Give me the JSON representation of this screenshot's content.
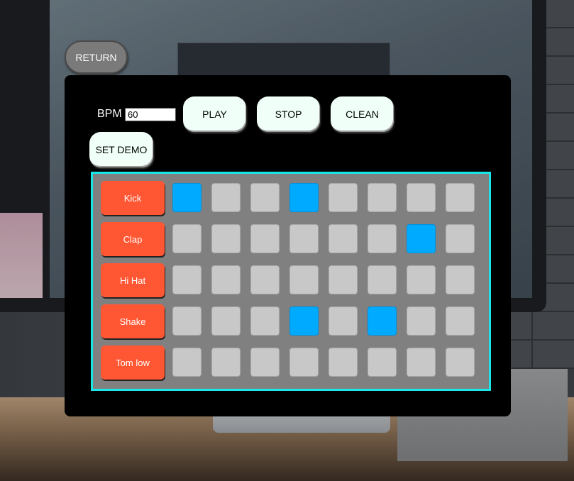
{
  "nav": {
    "return_label": "RETURN"
  },
  "controls": {
    "bpm_label": "BPM",
    "bpm_value": "60",
    "play_label": "PLAY",
    "stop_label": "STOP",
    "clean_label": "CLEAN",
    "set_demo_label": "SET DEMO"
  },
  "sequencer": {
    "steps": 8,
    "active_color": "#00aaff",
    "inactive_color": "#c8c8c8",
    "instrument_color": "#ff5733",
    "grid_border_color": "#19e6e6",
    "tracks": [
      {
        "label": "Kick",
        "pattern": [
          1,
          0,
          0,
          1,
          0,
          0,
          0,
          0
        ]
      },
      {
        "label": "Clap",
        "pattern": [
          0,
          0,
          0,
          0,
          0,
          0,
          1,
          0
        ]
      },
      {
        "label": "Hi Hat",
        "pattern": [
          0,
          0,
          0,
          0,
          0,
          0,
          0,
          0
        ]
      },
      {
        "label": "Shake",
        "pattern": [
          0,
          0,
          0,
          1,
          0,
          1,
          0,
          0
        ]
      },
      {
        "label": "Tom low",
        "pattern": [
          0,
          0,
          0,
          0,
          0,
          0,
          0,
          0
        ]
      }
    ]
  }
}
